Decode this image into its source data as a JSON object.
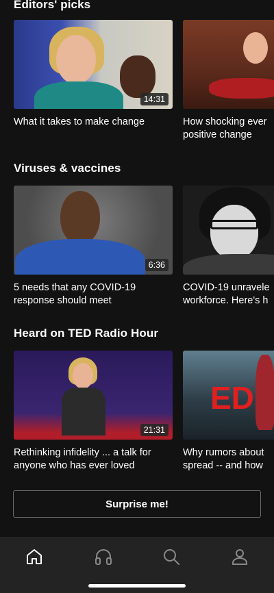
{
  "sections": [
    {
      "title": "Editors' picks",
      "cards": [
        {
          "caption_lines": [
            "What it takes to make change",
            ""
          ],
          "duration": "14:31"
        },
        {
          "caption_lines": [
            "How shocking ever",
            "positive change"
          ],
          "duration": ""
        }
      ]
    },
    {
      "title": "Viruses & vaccines",
      "cards": [
        {
          "caption_lines": [
            "5 needs that any COVID-19",
            "response should meet"
          ],
          "duration": "6:36"
        },
        {
          "caption_lines": [
            "COVID-19 unravele",
            "workforce. Here's h"
          ],
          "duration": ""
        }
      ]
    },
    {
      "title": "Heard on TED Radio Hour",
      "cards": [
        {
          "caption_lines": [
            "Rethinking infidelity ... a talk for",
            "anyone who has ever loved"
          ],
          "duration": "21:31"
        },
        {
          "caption_lines": [
            "Why rumors about",
            "spread -- and how"
          ],
          "duration": ""
        }
      ]
    }
  ],
  "thumbnail_logo_text": "ED",
  "surprise_button": "Surprise me!",
  "tabbar": {
    "items": [
      {
        "icon": "home-icon",
        "active": true
      },
      {
        "icon": "headphones-icon",
        "active": false
      },
      {
        "icon": "search-icon",
        "active": false
      },
      {
        "icon": "profile-icon",
        "active": false
      }
    ]
  },
  "colors": {
    "background": "#121212",
    "tabbar": "#232323",
    "accent": "#e62b1e"
  }
}
